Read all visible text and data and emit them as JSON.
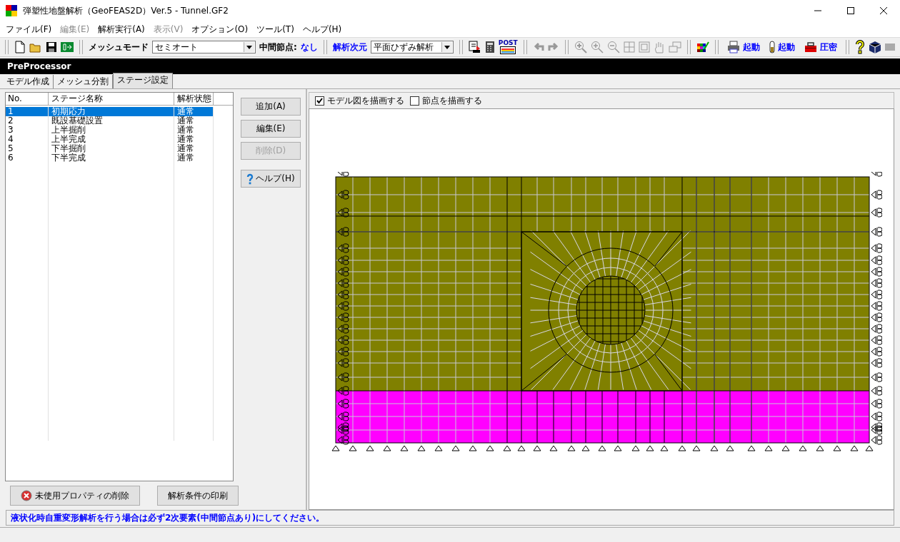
{
  "window": {
    "title": "弾塑性地盤解析（GeoFEAS2D）Ver.5 - Tunnel.GF2"
  },
  "menu": [
    {
      "label": "ファイル(F)",
      "disabled": false
    },
    {
      "label": "編集(E)",
      "disabled": true
    },
    {
      "label": "解析実行(A)",
      "disabled": false
    },
    {
      "label": "表示(V)",
      "disabled": true
    },
    {
      "label": "オプション(O)",
      "disabled": false
    },
    {
      "label": "ツール(T)",
      "disabled": false
    },
    {
      "label": "ヘルプ(H)",
      "disabled": false
    }
  ],
  "toolbar": {
    "mesh_mode_label": "メッシュモード",
    "mesh_mode_value": "セミオート",
    "midnode_label": "中間節点:",
    "midnode_value": "なし",
    "dimension_label": "解析次元",
    "dimension_value": "平面ひずみ解析",
    "post_icon_text": "POST",
    "launchers": [
      {
        "kind": "printer",
        "label": "起動"
      },
      {
        "kind": "tube",
        "label": "起動"
      },
      {
        "kind": "toolbox",
        "label": "圧密"
      }
    ]
  },
  "panel_title": "PreProcessor",
  "tabs": [
    {
      "label": "モデル作成",
      "selected": false
    },
    {
      "label": "メッシュ分割",
      "selected": false
    },
    {
      "label": "ステージ設定",
      "selected": true
    }
  ],
  "table": {
    "columns": [
      "No.",
      "ステージ名称",
      "解析状態"
    ],
    "rows": [
      {
        "cells": [
          "1",
          "初期応力",
          "通常"
        ],
        "selected": true
      },
      {
        "cells": [
          "2",
          "既設基礎設置",
          "通常"
        ],
        "selected": false
      },
      {
        "cells": [
          "3",
          "上半掘削",
          "通常"
        ],
        "selected": false
      },
      {
        "cells": [
          "4",
          "上半完成",
          "通常"
        ],
        "selected": false
      },
      {
        "cells": [
          "5",
          "下半掘削",
          "通常"
        ],
        "selected": false
      },
      {
        "cells": [
          "6",
          "下半完成",
          "通常"
        ],
        "selected": false
      }
    ]
  },
  "stage_buttons": [
    {
      "label": "追加(A)",
      "disabled": false
    },
    {
      "label": "編集(E)",
      "disabled": false
    },
    {
      "label": "削除(D)",
      "disabled": true
    }
  ],
  "help_button": "ヘルプ(H)",
  "view_options": [
    {
      "label": "モデル図を描画する",
      "checked": true
    },
    {
      "label": "節点を描画する",
      "checked": false
    }
  ],
  "bottom_buttons": [
    {
      "label": "未使用プロパティの削除",
      "kind": "delete"
    },
    {
      "label": "解析条件の印刷",
      "kind": "plain"
    }
  ],
  "status_message": "液状化時自重変形解析を行う場合は必ず2次要素(中間節点あり)にしてください。"
}
